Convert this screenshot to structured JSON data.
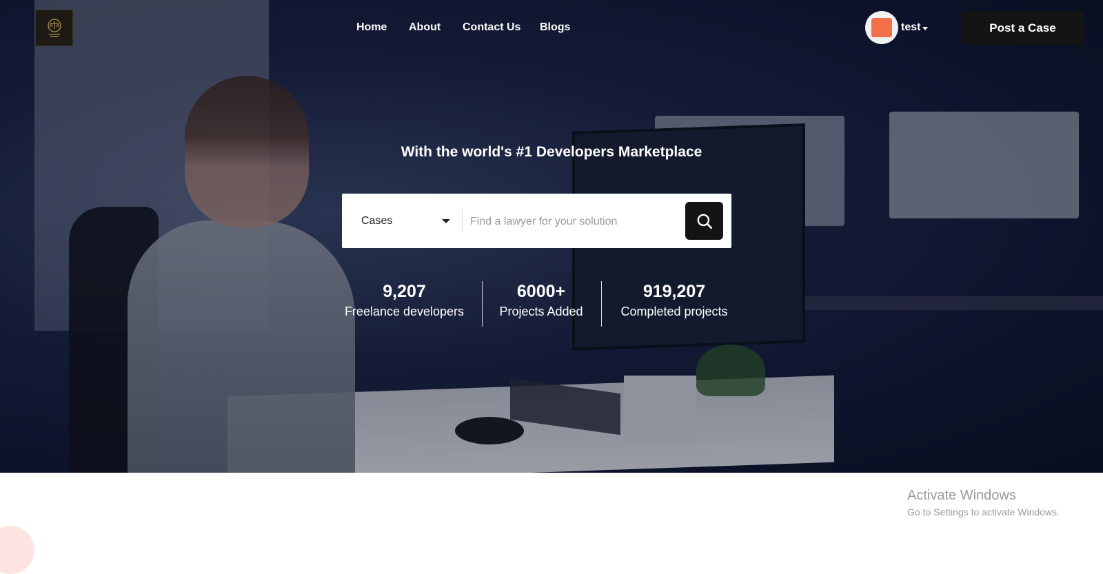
{
  "nav": {
    "items": [
      {
        "label": "Home"
      },
      {
        "label": "About"
      },
      {
        "label": "Contact Us"
      },
      {
        "label": "Blogs"
      }
    ]
  },
  "user": {
    "name": "test",
    "avatar_icon": "tshirt-avatar-icon",
    "avatar_color": "#f36f4a"
  },
  "header": {
    "post_case_label": "Post a Case"
  },
  "hero": {
    "headline": "With the world's #1 Developers Marketplace"
  },
  "search": {
    "category_selected": "Cases",
    "placeholder": "Find a lawyer for your solution",
    "value": "",
    "button_icon": "search-icon"
  },
  "stats": [
    {
      "number": "9,207",
      "label": "Freelance developers"
    },
    {
      "number": "6000+",
      "label": "Projects Added"
    },
    {
      "number": "919,207",
      "label": "Completed projects"
    }
  ],
  "watermark": {
    "title": "Activate Windows",
    "subtitle": "Go to Settings to activate Windows."
  },
  "colors": {
    "button_dark": "#141414",
    "text_on_hero": "#ffffff"
  }
}
